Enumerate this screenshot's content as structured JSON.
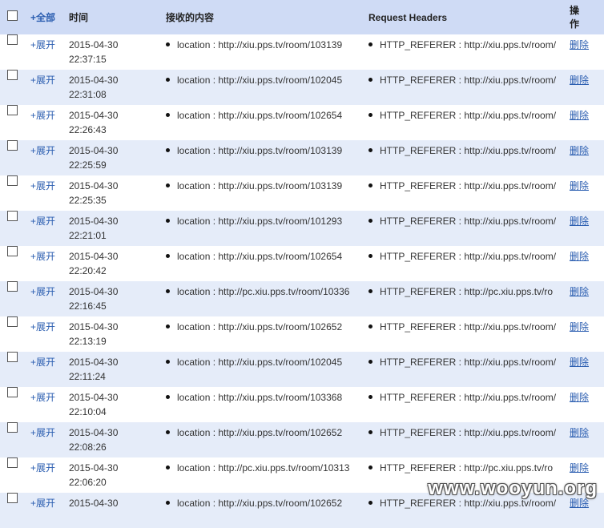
{
  "header": {
    "select_all": "+全部",
    "time": "时间",
    "received": "接收的内容",
    "request_headers": "Request Headers",
    "operation": "操作"
  },
  "rows": [
    {
      "expand": "+展开",
      "date": "2015-04-30",
      "time": "22:37:15",
      "location": "location : http://xiu.pps.tv/room/103139",
      "referer": "HTTP_REFERER : http://xiu.pps.tv/room/",
      "delete": "删除"
    },
    {
      "expand": "+展开",
      "date": "2015-04-30",
      "time": "22:31:08",
      "location": "location : http://xiu.pps.tv/room/102045",
      "referer": "HTTP_REFERER : http://xiu.pps.tv/room/",
      "delete": "删除"
    },
    {
      "expand": "+展开",
      "date": "2015-04-30",
      "time": "22:26:43",
      "location": "location : http://xiu.pps.tv/room/102654",
      "referer": "HTTP_REFERER : http://xiu.pps.tv/room/",
      "delete": "删除"
    },
    {
      "expand": "+展开",
      "date": "2015-04-30",
      "time": "22:25:59",
      "location": "location : http://xiu.pps.tv/room/103139",
      "referer": "HTTP_REFERER : http://xiu.pps.tv/room/",
      "delete": "删除"
    },
    {
      "expand": "+展开",
      "date": "2015-04-30",
      "time": "22:25:35",
      "location": "location : http://xiu.pps.tv/room/103139",
      "referer": "HTTP_REFERER : http://xiu.pps.tv/room/",
      "delete": "删除"
    },
    {
      "expand": "+展开",
      "date": "2015-04-30",
      "time": "22:21:01",
      "location": "location : http://xiu.pps.tv/room/101293",
      "referer": "HTTP_REFERER : http://xiu.pps.tv/room/",
      "delete": "删除"
    },
    {
      "expand": "+展开",
      "date": "2015-04-30",
      "time": "22:20:42",
      "location": "location : http://xiu.pps.tv/room/102654",
      "referer": "HTTP_REFERER : http://xiu.pps.tv/room/",
      "delete": "删除"
    },
    {
      "expand": "+展开",
      "date": "2015-04-30",
      "time": "22:16:45",
      "location": "location : http://pc.xiu.pps.tv/room/10336",
      "referer": "HTTP_REFERER : http://pc.xiu.pps.tv/ro",
      "delete": "删除"
    },
    {
      "expand": "+展开",
      "date": "2015-04-30",
      "time": "22:13:19",
      "location": "location : http://xiu.pps.tv/room/102652",
      "referer": "HTTP_REFERER : http://xiu.pps.tv/room/",
      "delete": "删除"
    },
    {
      "expand": "+展开",
      "date": "2015-04-30",
      "time": "22:11:24",
      "location": "location : http://xiu.pps.tv/room/102045",
      "referer": "HTTP_REFERER : http://xiu.pps.tv/room/",
      "delete": "删除"
    },
    {
      "expand": "+展开",
      "date": "2015-04-30",
      "time": "22:10:04",
      "location": "location : http://xiu.pps.tv/room/103368",
      "referer": "HTTP_REFERER : http://xiu.pps.tv/room/",
      "delete": "删除"
    },
    {
      "expand": "+展开",
      "date": "2015-04-30",
      "time": "22:08:26",
      "location": "location : http://xiu.pps.tv/room/102652",
      "referer": "HTTP_REFERER : http://xiu.pps.tv/room/",
      "delete": "删除"
    },
    {
      "expand": "+展开",
      "date": "2015-04-30",
      "time": "22:06:20",
      "location": "location : http://pc.xiu.pps.tv/room/10313",
      "referer": "HTTP_REFERER : http://pc.xiu.pps.tv/ro",
      "delete": "删除"
    },
    {
      "expand": "+展开",
      "date": "2015-04-30",
      "time": "",
      "location": "location : http://xiu.pps.tv/room/102652",
      "referer": "HTTP_REFERER : http://xiu.pps.tv/room/",
      "delete": "删除"
    }
  ],
  "watermark": "www.wooyun.org",
  "colors": {
    "header_bg": "#cfdbf5",
    "stripe_bg": "#e5ecf9",
    "link": "#2a5db0"
  }
}
